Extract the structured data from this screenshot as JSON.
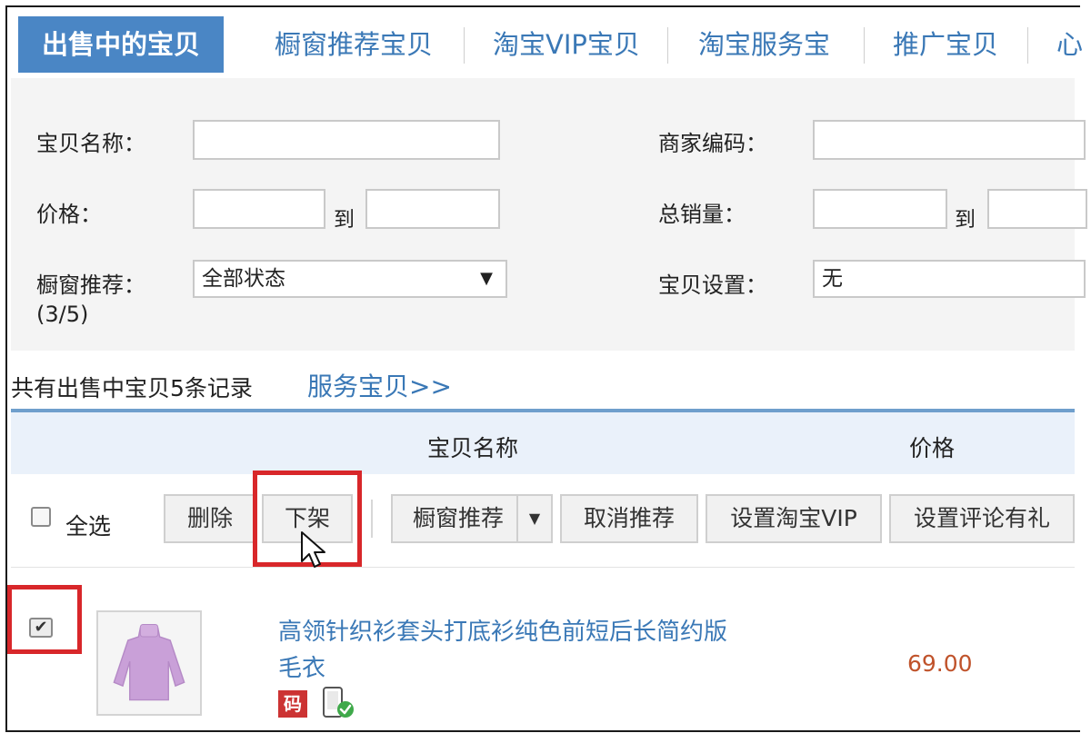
{
  "tabs": [
    {
      "label": "出售中的宝贝",
      "active": true
    },
    {
      "label": "橱窗推荐宝贝",
      "active": false
    },
    {
      "label": "淘宝VIP宝贝",
      "active": false
    },
    {
      "label": "淘宝服务宝",
      "active": false
    },
    {
      "label": "推广宝贝",
      "active": false
    },
    {
      "label": "心",
      "active": false
    }
  ],
  "filters": {
    "item_name_label": "宝贝名称：",
    "item_name_value": "",
    "merchant_code_label": "商家编码：",
    "merchant_code_value": "",
    "price_label": "价格：",
    "price_from": "",
    "price_to": "",
    "to_text": "到",
    "total_sales_label": "总销量：",
    "sales_from": "",
    "sales_to": "",
    "window_label": "橱窗推荐：",
    "window_count": "(3/5)",
    "window_select_value": "全部状态",
    "item_setting_label": "宝贝设置：",
    "item_setting_value": "无"
  },
  "summary": {
    "record_text": "共有出售中宝贝5条记录",
    "service_link": "服务宝贝>>"
  },
  "table_header": {
    "col_name": "宝贝名称",
    "col_price": "价格"
  },
  "actions": {
    "select_all": "全选",
    "delete": "删除",
    "delist": "下架",
    "window_recommend": "橱窗推荐",
    "cancel_recommend": "取消推荐",
    "set_vip": "设置淘宝VIP",
    "set_review_gift": "设置评论有礼"
  },
  "items": [
    {
      "title": "高领针织衫套头打底衫纯色前短后长简约版毛衣",
      "price": "69.00",
      "code_badge": "码",
      "checked": true
    }
  ],
  "colors": {
    "tab_active_bg": "#4a86c5",
    "link": "#3a78b6",
    "highlight": "#d8272a",
    "price": "#c0532b"
  }
}
